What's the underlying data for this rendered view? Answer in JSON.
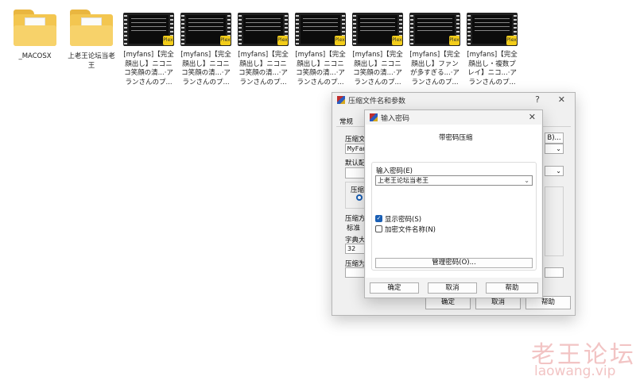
{
  "desktop": {
    "items": [
      {
        "type": "folder",
        "label": "_MACOSX"
      },
      {
        "type": "folder",
        "label": "上老王论坛当老王"
      },
      {
        "type": "video",
        "label": "[myfans]【完全顔出し】ニコニコ笑顔の清...·アランさんのプ..."
      },
      {
        "type": "video",
        "label": "[myfans]【完全顔出し】ニコニコ笑顔の清...·アランさんのプ..."
      },
      {
        "type": "video",
        "label": "[myfans]【完全顔出し】ニコニコ笑顔の清...·アランさんのプ..."
      },
      {
        "type": "video",
        "label": "[myfans]【完全顔出し】ニコニコ笑顔の清...·アランさんのプ..."
      },
      {
        "type": "video",
        "label": "[myfans]【完全顔出し】ニコニコ笑顔の清...·アランさんのプ..."
      },
      {
        "type": "video",
        "label": "[myfans]【完全顔出し】ファンが多すぎる...·アランさんのプ..."
      },
      {
        "type": "video",
        "label": "[myfans]【完全顔出し・複数プレイ】ニコ...·アランさんのプ..."
      }
    ],
    "badge_text": "Plex"
  },
  "archive_dialog": {
    "title": "压缩文件名和参数",
    "help_btn": "?",
    "close_btn": "✕",
    "tab_general": "常规",
    "archive_name_label": "压缩文",
    "archive_name_value": "MyFans",
    "browse_btn": "B)...",
    "default_profile_label": "默认配",
    "format_label": "压缩文",
    "method_label": "压缩方",
    "method_value": "标准",
    "dict_label": "字典大",
    "dict_value": "32",
    "split_label": "压缩为",
    "ok_btn": "确定",
    "cancel_btn": "取消",
    "help_action_btn": "帮助"
  },
  "password_dialog": {
    "title": "输入密码",
    "close_btn": "✕",
    "heading": "带密码压缩",
    "group_label": "输入密码(E)",
    "password_value": "上老王论坛当老王",
    "show_password_label": "显示密码(S)",
    "show_password_checked": true,
    "encrypt_names_label": "加密文件名称(N)",
    "encrypt_names_checked": false,
    "manage_btn": "管理密码(O)...",
    "ok_btn": "确定",
    "cancel_btn": "取消",
    "help_btn": "帮助"
  },
  "watermark": {
    "line1": "老王论坛",
    "line2": "laowang.vip"
  }
}
